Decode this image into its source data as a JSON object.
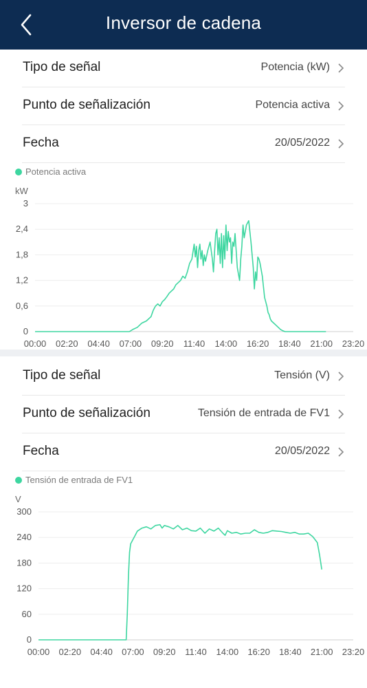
{
  "header": {
    "title": "Inversor de cadena",
    "back_icon": "chevron-left-icon"
  },
  "colors": {
    "header_bg": "#0d2c52",
    "series": "#3dd6a0"
  },
  "panels": [
    {
      "rows": [
        {
          "label": "Tipo de señal",
          "value": "Potencia (kW)"
        },
        {
          "label": "Punto de señalización",
          "value": "Potencia activa"
        },
        {
          "label": "Fecha",
          "value": "20/05/2022"
        }
      ],
      "legend": "Potencia activa"
    },
    {
      "rows": [
        {
          "label": "Tipo de señal",
          "value": "Tensión (V)"
        },
        {
          "label": "Punto de señalización",
          "value": "Tensión de entrada de FV1"
        },
        {
          "label": "Fecha",
          "value": "20/05/2022"
        }
      ],
      "legend": "Tensión de entrada de FV1"
    }
  ],
  "chart_data": [
    {
      "type": "line",
      "title": "",
      "unit": "kW",
      "xlabel": "",
      "ylabel": "kW",
      "xlim_minutes": [
        0,
        1400
      ],
      "ylim": [
        0,
        3
      ],
      "y_ticks": [
        "0",
        "0,6",
        "1,2",
        "1,8",
        "2,4",
        "3"
      ],
      "y_tick_values": [
        0,
        0.6,
        1.2,
        1.8,
        2.4,
        3
      ],
      "x_ticks": [
        "00:00",
        "02:20",
        "04:40",
        "07:00",
        "09:20",
        "11:40",
        "14:00",
        "16:20",
        "18:40",
        "21:00",
        "23:20"
      ],
      "grid": true,
      "series": [
        {
          "name": "Potencia activa",
          "x": [
            "00:00",
            "06:55",
            "07:10",
            "07:30",
            "07:50",
            "08:10",
            "08:30",
            "08:40",
            "08:50",
            "09:00",
            "09:10",
            "09:20",
            "09:30",
            "09:40",
            "09:50",
            "10:00",
            "10:10",
            "10:20",
            "10:30",
            "10:40",
            "10:50",
            "11:00",
            "11:10",
            "11:20",
            "11:30",
            "11:40",
            "11:45",
            "11:50",
            "11:55",
            "12:00",
            "12:05",
            "12:10",
            "12:15",
            "12:20",
            "12:25",
            "12:30",
            "12:40",
            "12:50",
            "13:00",
            "13:05",
            "13:10",
            "13:15",
            "13:20",
            "13:25",
            "13:30",
            "13:35",
            "13:40",
            "13:45",
            "13:50",
            "13:55",
            "14:00",
            "14:05",
            "14:10",
            "14:15",
            "14:20",
            "14:25",
            "14:30",
            "14:35",
            "14:40",
            "14:50",
            "15:00",
            "15:05",
            "15:10",
            "15:15",
            "15:20",
            "15:30",
            "15:40",
            "15:50",
            "16:00",
            "16:05",
            "16:10",
            "16:15",
            "16:20",
            "16:25",
            "16:30",
            "16:40",
            "16:50",
            "17:00",
            "17:05",
            "17:10",
            "17:15",
            "17:20",
            "17:30",
            "17:40",
            "17:50",
            "18:00",
            "18:10",
            "18:20",
            "18:30",
            "18:40",
            "19:00",
            "19:20",
            "19:40",
            "20:00",
            "20:20",
            "20:40",
            "21:00",
            "21:20"
          ],
          "y": [
            0,
            0,
            0.05,
            0.1,
            0.2,
            0.25,
            0.35,
            0.5,
            0.6,
            0.65,
            0.6,
            0.7,
            0.75,
            0.82,
            0.9,
            0.95,
            1.0,
            1.1,
            1.15,
            1.2,
            1.3,
            1.25,
            1.4,
            1.6,
            1.7,
            2.05,
            1.75,
            2.0,
            1.5,
            1.9,
            2.05,
            1.7,
            1.9,
            1.55,
            1.8,
            1.65,
            1.9,
            2.1,
            1.7,
            1.4,
            1.9,
            2.3,
            2.4,
            1.8,
            2.2,
            1.6,
            2.3,
            1.5,
            2.25,
            1.7,
            2.5,
            1.9,
            2.35,
            2.1,
            2.2,
            1.6,
            2.1,
            2.0,
            2.3,
            1.5,
            1.2,
            1.7,
            2.0,
            2.5,
            2.2,
            2.5,
            2.6,
            2.1,
            1.5,
            1.0,
            1.4,
            1.2,
            1.75,
            1.7,
            1.6,
            1.3,
            0.8,
            0.6,
            0.45,
            0.4,
            0.3,
            0.25,
            0.2,
            0.15,
            0.1,
            0.05,
            0.02,
            0,
            0,
            0,
            0,
            0,
            0,
            0,
            0,
            0,
            0,
            0
          ]
        }
      ]
    },
    {
      "type": "line",
      "title": "",
      "unit": "V",
      "xlabel": "",
      "ylabel": "V",
      "xlim_minutes": [
        0,
        1400
      ],
      "ylim": [
        0,
        300
      ],
      "y_ticks": [
        "0",
        "60",
        "120",
        "180",
        "240",
        "300"
      ],
      "y_tick_values": [
        0,
        60,
        120,
        180,
        240,
        300
      ],
      "x_ticks": [
        "00:00",
        "02:20",
        "04:40",
        "07:00",
        "09:20",
        "11:40",
        "14:00",
        "16:20",
        "18:40",
        "21:00",
        "23:20"
      ],
      "grid": true,
      "series": [
        {
          "name": "Tensión de entrada de FV1",
          "x": [
            "00:00",
            "06:30",
            "06:35",
            "06:40",
            "06:45",
            "06:50",
            "07:00",
            "07:10",
            "07:20",
            "07:40",
            "08:00",
            "08:20",
            "08:40",
            "09:00",
            "09:10",
            "09:20",
            "09:40",
            "10:00",
            "10:20",
            "10:40",
            "11:00",
            "11:20",
            "11:40",
            "12:00",
            "12:20",
            "12:40",
            "13:00",
            "13:20",
            "13:40",
            "13:50",
            "14:00",
            "14:20",
            "14:40",
            "15:00",
            "15:20",
            "15:40",
            "16:00",
            "16:20",
            "16:40",
            "17:00",
            "17:20",
            "17:40",
            "18:00",
            "18:20",
            "18:40",
            "19:00",
            "19:20",
            "19:40",
            "20:00",
            "20:20",
            "20:40",
            "20:50",
            "21:00"
          ],
          "y": [
            0,
            0,
            60,
            150,
            205,
            225,
            235,
            245,
            255,
            262,
            265,
            260,
            268,
            270,
            262,
            268,
            265,
            260,
            268,
            258,
            262,
            256,
            255,
            262,
            250,
            260,
            255,
            262,
            250,
            245,
            256,
            250,
            252,
            248,
            250,
            250,
            258,
            252,
            250,
            252,
            256,
            255,
            254,
            252,
            250,
            252,
            248,
            248,
            250,
            242,
            228,
            200,
            165
          ]
        }
      ]
    }
  ]
}
